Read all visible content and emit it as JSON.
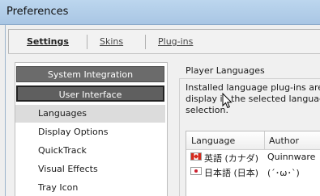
{
  "window": {
    "title": "Preferences"
  },
  "tabs": [
    {
      "label": "Settings",
      "active": true
    },
    {
      "label": "Skins",
      "active": false
    },
    {
      "label": "Plug-ins",
      "active": false
    }
  ],
  "nav": {
    "groups": [
      {
        "label": "System Integration",
        "selected": false
      },
      {
        "label": "User Interface",
        "selected": true
      }
    ],
    "items": [
      {
        "label": "Languages",
        "selected": true
      },
      {
        "label": "Display Options",
        "selected": false
      },
      {
        "label": "QuickTrack",
        "selected": false
      },
      {
        "label": "Visual Effects",
        "selected": false
      },
      {
        "label": "Tray Icon",
        "selected": false
      }
    ]
  },
  "content": {
    "group_label": "Player Languages",
    "description_lines": [
      "Installed language plug-ins are liste",
      "display in the selected language, h",
      "selection."
    ],
    "table": {
      "columns": [
        "Language",
        "Author"
      ],
      "rows": [
        {
          "flag": "canada-flag-icon",
          "language": "英語 (カナダ)",
          "author": "Quinnware"
        },
        {
          "flag": "japan-flag-icon",
          "language": "日本語 (日本)",
          "author": "(´･ω･`)"
        }
      ]
    }
  },
  "colors": {
    "titlebar": "#bcd6ee",
    "nav_group_bg": "#6b6b6b",
    "nav_selected_bg": "#dcdcdc"
  }
}
